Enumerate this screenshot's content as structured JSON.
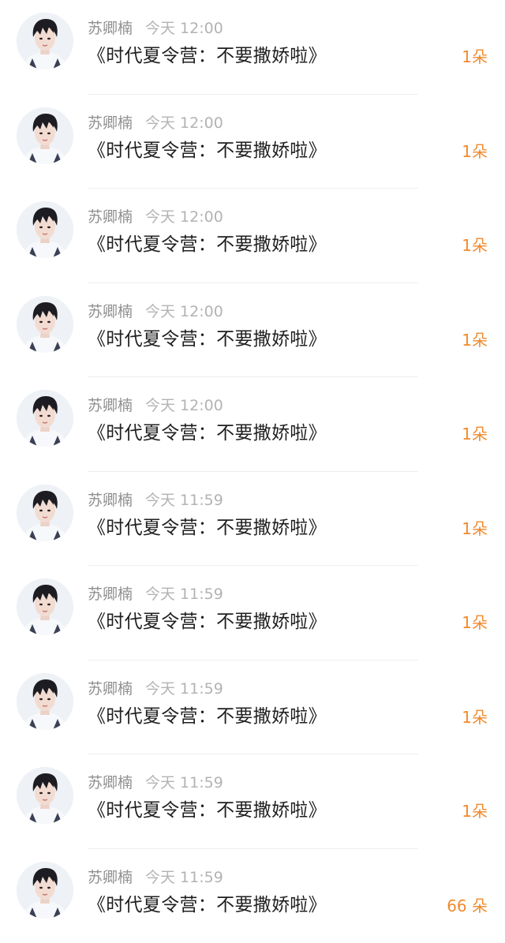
{
  "items": [
    {
      "user": "苏卿楠",
      "time": "今天 12:00",
      "title": "《时代夏令营：不要撒娇啦》",
      "gift": "1朵",
      "avatar_icon": "user-avatar"
    },
    {
      "user": "苏卿楠",
      "time": "今天 12:00",
      "title": "《时代夏令营：不要撒娇啦》",
      "gift": "1朵",
      "avatar_icon": "user-avatar"
    },
    {
      "user": "苏卿楠",
      "time": "今天 12:00",
      "title": "《时代夏令营：不要撒娇啦》",
      "gift": "1朵",
      "avatar_icon": "user-avatar"
    },
    {
      "user": "苏卿楠",
      "time": "今天 12:00",
      "title": "《时代夏令营：不要撒娇啦》",
      "gift": "1朵",
      "avatar_icon": "user-avatar"
    },
    {
      "user": "苏卿楠",
      "time": "今天 12:00",
      "title": "《时代夏令营：不要撒娇啦》",
      "gift": "1朵",
      "avatar_icon": "user-avatar"
    },
    {
      "user": "苏卿楠",
      "time": "今天 11:59",
      "title": "《时代夏令营：不要撒娇啦》",
      "gift": "1朵",
      "avatar_icon": "user-avatar"
    },
    {
      "user": "苏卿楠",
      "time": "今天 11:59",
      "title": "《时代夏令营：不要撒娇啦》",
      "gift": "1朵",
      "avatar_icon": "user-avatar"
    },
    {
      "user": "苏卿楠",
      "time": "今天 11:59",
      "title": "《时代夏令营：不要撒娇啦》",
      "gift": "1朵",
      "avatar_icon": "user-avatar"
    },
    {
      "user": "苏卿楠",
      "time": "今天 11:59",
      "title": "《时代夏令营：不要撒娇啦》",
      "gift": "1朵",
      "avatar_icon": "user-avatar"
    },
    {
      "user": "苏卿楠",
      "time": "今天 11:59",
      "title": "《时代夏令营：不要撒娇啦》",
      "gift": "66 朵",
      "avatar_icon": "user-avatar"
    }
  ],
  "colors": {
    "gift_orange": "#f08a2e",
    "name_gray": "#8f8f8f",
    "time_gray": "#b3b3b3",
    "title_black": "#1f1f1f",
    "divider": "#efefef"
  }
}
